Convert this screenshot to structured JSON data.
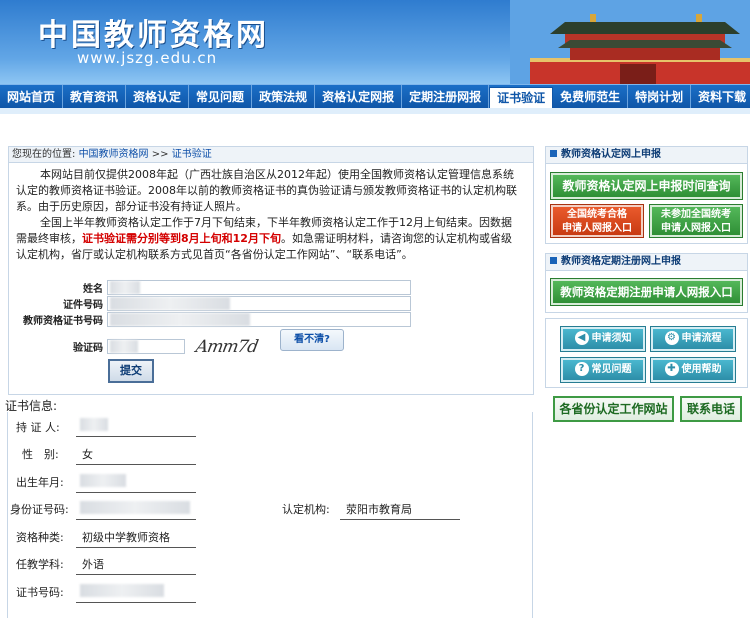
{
  "header": {
    "title": "中国教师资格网",
    "url": "www.jszg.edu.cn"
  },
  "nav": {
    "items": [
      {
        "label": "网站首页"
      },
      {
        "label": "教育资讯"
      },
      {
        "label": "资格认定"
      },
      {
        "label": "常见问题"
      },
      {
        "label": "政策法规"
      },
      {
        "label": "资格认定网报"
      },
      {
        "label": "定期注册网报"
      },
      {
        "label": "证书验证"
      },
      {
        "label": "免费师范生"
      },
      {
        "label": "特岗计划"
      },
      {
        "label": "资料下载"
      }
    ],
    "active_index": 7
  },
  "breadcrumb": {
    "prefix": "您现在的位置:",
    "home": "中国教师资格网",
    "sep": ">>",
    "current": "证书验证"
  },
  "notice": {
    "p1": "本网站目前仅提供2008年起（广西壮族自治区从2012年起）使用全国教师资格认定管理信息系统认定的教师资格证书验证。2008年以前的教师资格证书的真伪验证请与颁发教师资格证书的认定机构联系。由于历史原因，部分证书没有持证人照片。",
    "p2_before": "全国上半年教师资格认定工作于7月下旬结束，下半年教师资格认定工作于12月上旬结束。因数据需最终审核，",
    "p2_highlight": "证书验证需分别等到8月上旬和12月下旬",
    "p2_after": "。如急需证明材料，请咨询您的认定机构或省级认定机构，省厅或认定机构联系方式见首页“各省份认定工作网站”、“联系电话”。"
  },
  "form": {
    "name_label": "姓名",
    "cert_no_label": "证件号码",
    "teacher_cert_no_label": "教师资格证书号码",
    "vcode_label": "验证码",
    "captcha_text": "Amm7d",
    "unclear_label": "看不清?",
    "submit_label": "提交"
  },
  "cert": {
    "section_title": "证书信息:",
    "holder_label": "持 证 人:",
    "gender_label": "性　别:",
    "gender_value": "女",
    "birth_label": "出生年月:",
    "id_label": "身份证号码:",
    "org_label": "认定机构:",
    "org_value": "荥阳市教育局",
    "type_label": "资格种类:",
    "type_value": "初级中学教师资格",
    "subject_label": "任教学科:",
    "subject_value": "外语",
    "cert_no_label": "证书号码:"
  },
  "sidebar": {
    "section1_title": "教师资格认定网上申报",
    "query_btn": "教师资格认定网上申报时间查询",
    "unified_btn_line1": "全国统考合格",
    "unified_btn_line2": "申请人网报入口",
    "non_unified_btn_line1": "未参加全国统考",
    "non_unified_btn_line2": "申请人网报入口",
    "section2_title": "教师资格定期注册网上申报",
    "register_btn": "教师资格定期注册申请人网报入口",
    "notice_btn": "申请须知",
    "process_btn": "申请流程",
    "faq_btn": "常见问题",
    "help_btn": "使用帮助",
    "provinces_btn": "各省份认定工作网站",
    "phone_btn": "联系电话"
  },
  "colors": {
    "nav_blue": "#0f56a8",
    "highlight_red": "#d40000",
    "green_button": "#2f8f36",
    "red_button": "#c83a12"
  }
}
